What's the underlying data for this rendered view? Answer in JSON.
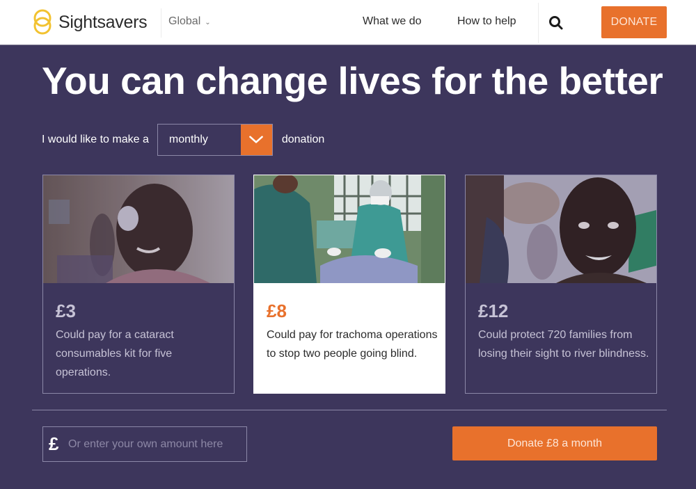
{
  "header": {
    "brand": "Sightsavers",
    "region": "Global",
    "nav": [
      {
        "label": "What we do"
      },
      {
        "label": "How to help"
      }
    ],
    "donate_label": "DONATE"
  },
  "hero": {
    "title": "You can change lives for the better"
  },
  "frequency": {
    "prefix": "I would like to make a",
    "selected": "monthly",
    "suffix": "donation"
  },
  "cards": [
    {
      "amount": "£3",
      "description": "Could pay for a cataract consumables kit for five operations.",
      "image": "child-with-eye-patch",
      "selected": false
    },
    {
      "amount": "£8",
      "description": "Could pay for trachoma operations to stop two people going blind.",
      "image": "surgeons-operating",
      "selected": true
    },
    {
      "amount": "£12",
      "description": "Could protect 720 families from losing their sight to river blindness.",
      "image": "smiling-girl",
      "selected": false
    }
  ],
  "custom_amount": {
    "currency_symbol": "£",
    "placeholder": "Or enter your own amount here",
    "value": ""
  },
  "submit_label": "Donate £8 a month",
  "colors": {
    "brand_orange": "#e8712c",
    "background_purple": "#3d365c",
    "logo_yellow": "#f2c230"
  }
}
